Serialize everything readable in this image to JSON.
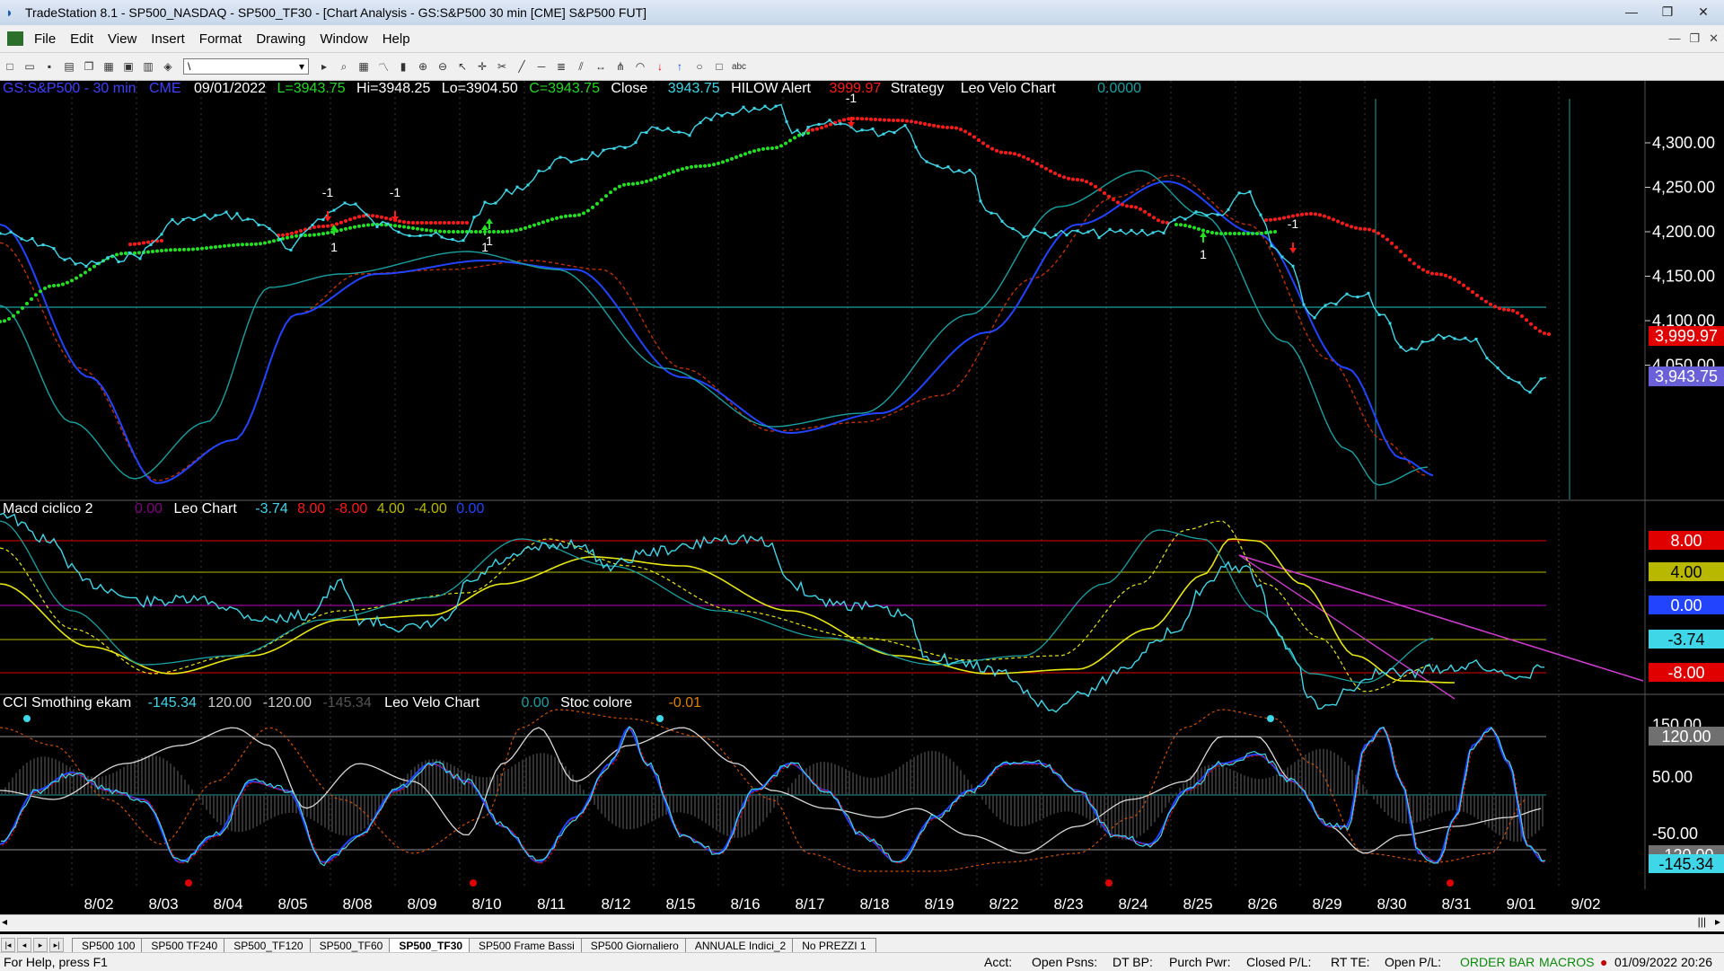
{
  "window": {
    "title": "TradeStation 8.1 - SP500_NASDAQ - SP500_TF30 - [Chart Analysis - GS:S&P500  30 min  [CME] S&P500 FUT]",
    "minimize": "—",
    "maximize": "❐",
    "close": "✕"
  },
  "menu": {
    "items": [
      "File",
      "Edit",
      "View",
      "Insert",
      "Format",
      "Drawing",
      "Window",
      "Help"
    ]
  },
  "toolbar": {
    "combo_value": "\\"
  },
  "price_panel": {
    "symbol": "GS:S&P500 - 30 min",
    "exchange": "CME",
    "date": "09/01/2022",
    "last": "L=3943.75",
    "high": "Hi=3948.25",
    "low": "Lo=3904.50",
    "close_val": "C=3943.75",
    "close_label": "Close",
    "close_value": "3943.75",
    "hilow_label": "HILOW Alert",
    "hilow_value": "3999.97",
    "strategy": "Strategy",
    "leo_velo": "Leo Velo Chart",
    "leo_velo_value": "0.0000",
    "axis_labels": [
      "4,300.00",
      "4,250.00",
      "4,200.00",
      "4,150.00",
      "4,100.00",
      "4,050.00"
    ],
    "marker_hilow": "3,999.97",
    "marker_last": "3,943.75",
    "signals": [
      "-1",
      "-1",
      "-1",
      "1",
      "1",
      "1",
      "-1",
      "1",
      "-1",
      "1"
    ]
  },
  "macd_panel": {
    "title": "Macd ciclico 2",
    "v1": "0.00",
    "leo": "Leo Chart",
    "v2": "-3.74",
    "v3": "8.00",
    "v4": "-8.00",
    "v5": "4.00",
    "v6": "-4.00",
    "v7": "0.00",
    "markers": [
      "8.00",
      "4.00",
      "0.00",
      "-3.74",
      "-8.00"
    ]
  },
  "cci_panel": {
    "title": "CCI Smothing ekam",
    "v1": "-145.34",
    "v2": "120.00",
    "v3": "-120.00",
    "v4": "-145.34",
    "leo": "Leo Velo Chart",
    "v5": "0.00",
    "stoc": "Stoc colore",
    "v6": "-0.01",
    "axis_labels": [
      "150.00",
      "50.00",
      "-50.00"
    ],
    "markers": [
      "120.00",
      "-120.00",
      "-145.34"
    ]
  },
  "x_axis": [
    "8/02",
    "8/03",
    "8/04",
    "8/05",
    "8/08",
    "8/09",
    "8/10",
    "8/11",
    "8/12",
    "8/15",
    "8/16",
    "8/17",
    "8/18",
    "8/19",
    "8/22",
    "8/23",
    "8/24",
    "8/25",
    "8/26",
    "8/29",
    "8/30",
    "8/31",
    "9/01",
    "9/02"
  ],
  "tabs": [
    "SP500 100",
    "SP500 TF240",
    "SP500_TF120",
    "SP500_TF60",
    "SP500_TF30",
    "SP500 Frame Bassi",
    "SP500 Giornaliero",
    "ANNUALE Indici_2",
    "No PREZZI 1"
  ],
  "active_tab": "SP500_TF30",
  "status": {
    "help": "For Help, press F1",
    "acct": "Acct:",
    "open_psns": "Open Psns:",
    "dt_bp": "DT BP:",
    "purch_pwr": "Purch Pwr:",
    "closed_pl": "Closed P/L:",
    "rt_te": "RT TE:",
    "open_pl": "Open P/L:",
    "order_bar": "ORDER BAR",
    "macros": "MACROS",
    "datetime": "01/09/2022 20:26"
  },
  "colors": {
    "cyan": "#3fd7e8",
    "red": "#ff1a1a",
    "green": "#22e022",
    "yellow": "#e6e614",
    "magenta": "#c83cc8",
    "blue": "#2244ff",
    "teal": "#1aa0a0",
    "darkred": "#c03000",
    "olive": "#b8b800"
  }
}
